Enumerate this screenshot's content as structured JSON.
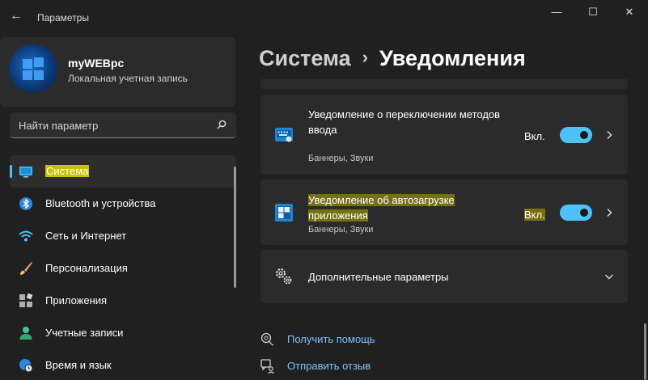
{
  "window": {
    "title": "Параметры",
    "back_glyph": "←",
    "minimize_glyph": "—",
    "maximize_glyph": "☐",
    "close_glyph": "✕"
  },
  "profile": {
    "name": "myWEBpc",
    "account_type": "Локальная учетная запись"
  },
  "search": {
    "placeholder": "Найти параметр"
  },
  "sidebar": {
    "items": [
      {
        "label": "Система",
        "icon": "monitor-icon",
        "active": true
      },
      {
        "label": "Bluetooth и устройства",
        "icon": "bluetooth-icon"
      },
      {
        "label": "Сеть и Интернет",
        "icon": "wifi-icon"
      },
      {
        "label": "Персонализация",
        "icon": "brush-icon"
      },
      {
        "label": "Приложения",
        "icon": "apps-icon"
      },
      {
        "label": "Учетные записи",
        "icon": "person-icon"
      },
      {
        "label": "Время и язык",
        "icon": "globe-clock-icon"
      }
    ]
  },
  "breadcrumb": {
    "parent": "Система",
    "separator": "›",
    "current": "Уведомления"
  },
  "notifications": [
    {
      "title": "Уведомление о переключении методов ввода",
      "subtitle": "Баннеры, Звуки",
      "state": "Вкл.",
      "enabled": true,
      "icon": "keyboard-switch-icon"
    },
    {
      "title": "Уведомление об автозагрузке приложения",
      "subtitle": "Баннеры, Звуки",
      "state": "Вкл.",
      "enabled": true,
      "icon": "startup-apps-icon"
    }
  ],
  "advanced": {
    "label": "Дополнительные параметры",
    "icon": "gears-icon"
  },
  "links": {
    "help": "Получить помощь",
    "feedback": "Отправить отзыв"
  },
  "colors": {
    "accent": "#4cc2ff",
    "background": "#202020",
    "card": "#2b2b2b",
    "highlight": "#c9c200"
  }
}
